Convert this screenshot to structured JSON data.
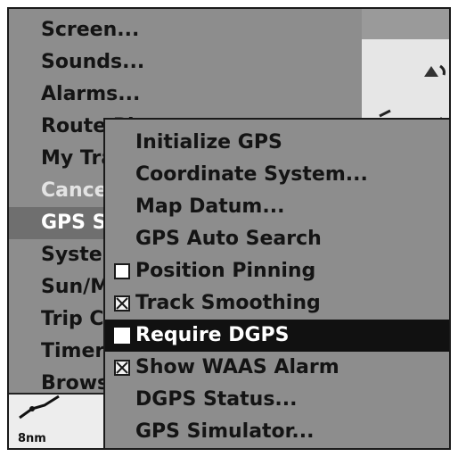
{
  "map": {
    "scale_label": "8nm"
  },
  "main_menu": {
    "items": [
      {
        "label": "Screen...",
        "state": "normal"
      },
      {
        "label": "Sounds...",
        "state": "normal"
      },
      {
        "label": "Alarms...",
        "state": "normal"
      },
      {
        "label": "Route Plan...",
        "state": "normal"
      },
      {
        "label": "My Trails...",
        "state": "normal"
      },
      {
        "label": "Cancel Nav",
        "state": "disabled"
      },
      {
        "label": "GPS Setup...",
        "state": "selected"
      },
      {
        "label": "System Setup...",
        "state": "normal"
      },
      {
        "label": "Sun/Moon...",
        "state": "normal"
      },
      {
        "label": "Trip Calc...",
        "state": "normal"
      },
      {
        "label": "Timers...",
        "state": "normal"
      },
      {
        "label": "Browse...",
        "state": "normal"
      }
    ]
  },
  "gps_submenu": {
    "items": [
      {
        "label": "Initialize GPS",
        "checkbox": "none"
      },
      {
        "label": "Coordinate System...",
        "checkbox": "none"
      },
      {
        "label": "Map Datum...",
        "checkbox": "none"
      },
      {
        "label": "GPS Auto Search",
        "checkbox": "none"
      },
      {
        "label": "Position Pinning",
        "checkbox": "unchecked"
      },
      {
        "label": "Track Smoothing",
        "checkbox": "checked"
      },
      {
        "label": "Require DGPS",
        "checkbox": "unchecked",
        "highlighted": true
      },
      {
        "label": "Show WAAS Alarm",
        "checkbox": "checked"
      },
      {
        "label": "DGPS Status...",
        "checkbox": "none"
      },
      {
        "label": "GPS Simulator...",
        "checkbox": "none"
      }
    ]
  },
  "colors": {
    "menu_bg": "#8d8d8d",
    "highlight_bg": "#111111",
    "selected_bg": "#6f6f6f"
  }
}
